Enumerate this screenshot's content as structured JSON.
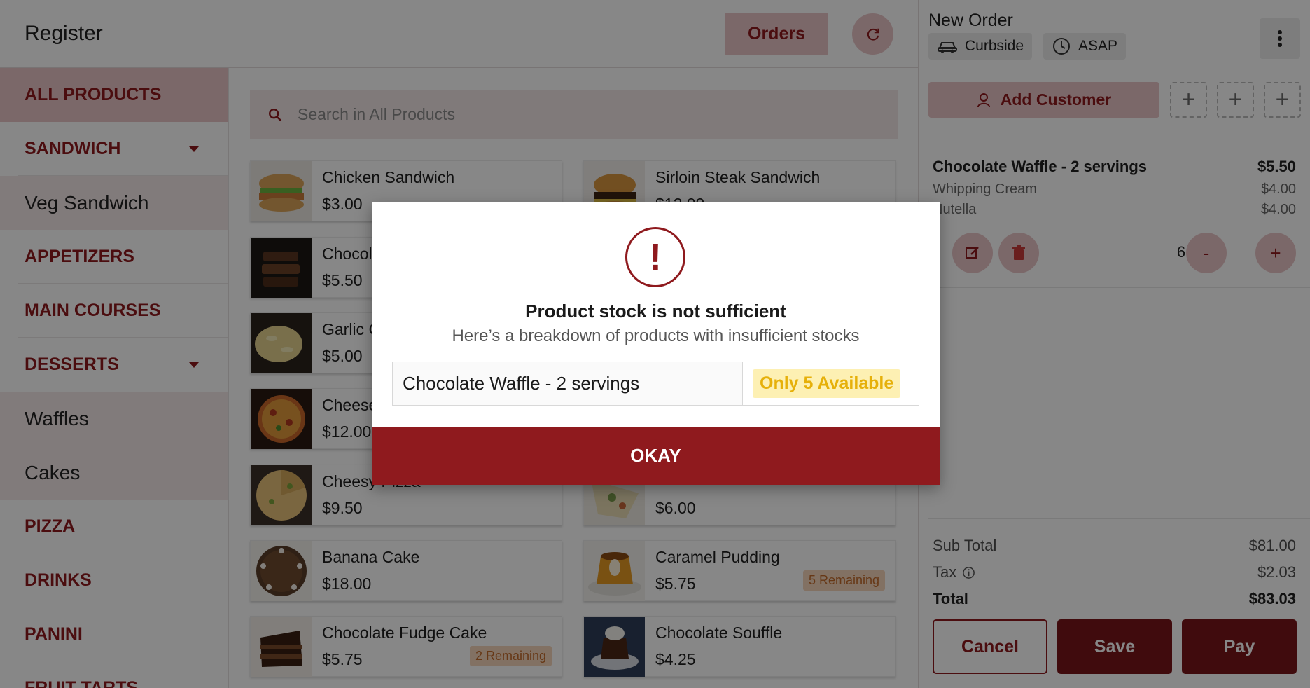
{
  "header": {
    "title": "Register",
    "orders_label": "Orders"
  },
  "categories": [
    {
      "label": "ALL PRODUCTS",
      "kind": "main",
      "active": true,
      "caret": false
    },
    {
      "label": "SANDWICH",
      "kind": "main",
      "active": false,
      "caret": true
    },
    {
      "label": "Veg Sandwich",
      "kind": "sub",
      "active": false,
      "caret": false
    },
    {
      "label": "APPETIZERS",
      "kind": "main",
      "active": false,
      "caret": false
    },
    {
      "label": "MAIN COURSES",
      "kind": "main",
      "active": false,
      "caret": false
    },
    {
      "label": "DESSERTS",
      "kind": "main",
      "active": false,
      "caret": true
    },
    {
      "label": "Waffles",
      "kind": "sub",
      "active": false,
      "caret": false
    },
    {
      "label": "Cakes",
      "kind": "sub",
      "active": false,
      "caret": false
    },
    {
      "label": "PIZZA",
      "kind": "main",
      "active": false,
      "caret": false
    },
    {
      "label": "DRINKS",
      "kind": "main",
      "active": false,
      "caret": false
    },
    {
      "label": "PANINI",
      "kind": "main",
      "active": false,
      "caret": false
    },
    {
      "label": "FRUIT TARTS",
      "kind": "main",
      "active": false,
      "caret": false
    }
  ],
  "search": {
    "placeholder": "Search in All Products"
  },
  "products": [
    {
      "name": "Chicken Sandwich",
      "price": "$3.00",
      "remaining": "",
      "thumb": "sandwich"
    },
    {
      "name": "Sirloin Steak Sandwich",
      "price": "$12.00",
      "remaining": "",
      "thumb": "burger"
    },
    {
      "name": "Chocolate Waffle - 2 servings",
      "price": "$5.50",
      "remaining": "",
      "thumb": "waffle"
    },
    {
      "name": "",
      "price": "",
      "remaining": "",
      "thumb": "hidden"
    },
    {
      "name": "Garlic Cheese Bread",
      "price": "$5.00",
      "remaining": "",
      "thumb": "bread"
    },
    {
      "name": "",
      "price": "",
      "remaining": "",
      "thumb": "hidden"
    },
    {
      "name": "Cheese Pizza",
      "price": "$12.00",
      "remaining": "",
      "thumb": "pizza"
    },
    {
      "name": "",
      "price": "",
      "remaining": "",
      "thumb": "hidden"
    },
    {
      "name": "Cheesy Pizza",
      "price": "$9.50",
      "remaining": "",
      "thumb": "pizza2"
    },
    {
      "name": "",
      "price": "$6.00",
      "remaining": "",
      "thumb": "wrap"
    },
    {
      "name": "Banana Cake",
      "price": "$18.00",
      "remaining": "",
      "thumb": "cake"
    },
    {
      "name": "Caramel Pudding",
      "price": "$5.75",
      "remaining": "5 Remaining",
      "thumb": "pudding"
    },
    {
      "name": "Chocolate Fudge Cake",
      "price": "$5.75",
      "remaining": "2 Remaining",
      "thumb": "fudge"
    },
    {
      "name": "Chocolate Souffle",
      "price": "$4.25",
      "remaining": "",
      "thumb": "souffle"
    }
  ],
  "order": {
    "title": "New Order",
    "mode": "Curbside",
    "time": "ASAP",
    "add_customer_label": "Add Customer",
    "plus": "+",
    "item": {
      "name": "Chocolate Waffle - 2 servings",
      "price": "$5.50",
      "modifiers": [
        {
          "name": "Whipping Cream",
          "price": "$4.00"
        },
        {
          "name": "Nutella",
          "price": "$4.00"
        }
      ],
      "quantity": "6",
      "minus": "-",
      "plus": "+"
    },
    "totals": {
      "subtotal_label": "Sub Total",
      "subtotal": "$81.00",
      "tax_label": "Tax",
      "tax": "$2.03",
      "total_label": "Total",
      "total": "$83.03"
    },
    "buttons": {
      "cancel": "Cancel",
      "save": "Save",
      "pay": "Pay"
    }
  },
  "modal": {
    "title": "Product stock is not sufficient",
    "subtitle": "Here’s a breakdown of products with insufficient stocks",
    "rows": [
      {
        "product": "Chocolate Waffle - 2 servings",
        "availability": "Only 5 Available"
      }
    ],
    "alert_glyph": "!",
    "okay_label": "OKAY"
  },
  "colors": {
    "brand": "#8f1a1e",
    "brand_light": "#e9c5c7",
    "warning_bg": "#fdf0b3",
    "warning_text": "#e6b00a",
    "remaining_bg": "#f6d6bb",
    "remaining_text": "#c26b2b"
  }
}
